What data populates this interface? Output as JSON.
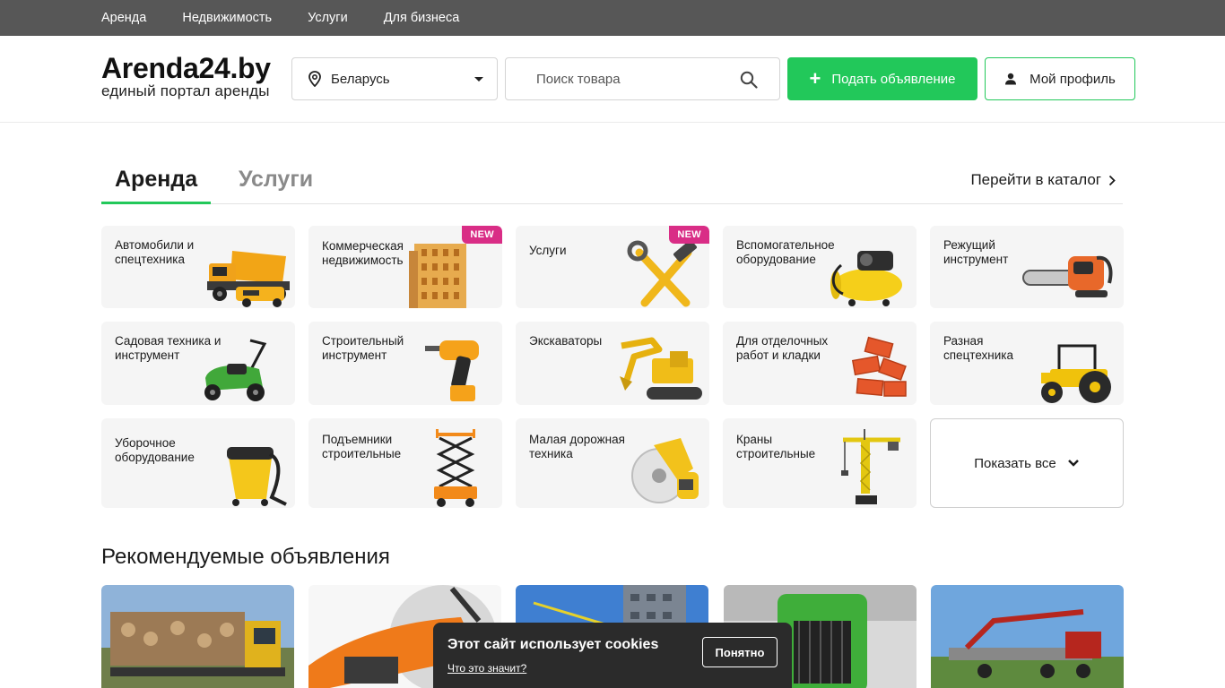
{
  "topnav": [
    "Аренда",
    "Недвижимость",
    "Услуги",
    "Для бизнеса"
  ],
  "header": {
    "logo_title": "Arenda24.by",
    "logo_sub": "единый портал аренды",
    "region": "Беларусь",
    "search_placeholder": "Поиск товара",
    "post_button": "Подать объявление",
    "profile_button": "Мой профиль"
  },
  "tabs": {
    "active": "Аренда",
    "inactive": "Услуги",
    "catalog_link": "Перейти в каталог"
  },
  "categories": [
    {
      "label": "Автомобили и спецтехника",
      "icon": "dump-truck-icon"
    },
    {
      "label": "Коммерческая недвижимость",
      "icon": "building-icon",
      "badge": "NEW"
    },
    {
      "label": "Услуги",
      "icon": "hammer-wrench-icon",
      "badge": "NEW"
    },
    {
      "label": "Вспомогательное оборудование",
      "icon": "compressor-icon"
    },
    {
      "label": "Режущий инструмент",
      "icon": "chainsaw-icon"
    },
    {
      "label": "Садовая техника и инструмент",
      "icon": "lawn-mower-icon"
    },
    {
      "label": "Строительный инструмент",
      "icon": "drill-icon"
    },
    {
      "label": "Экскаваторы",
      "icon": "excavator-icon"
    },
    {
      "label": "Для отделочных работ и кладки",
      "icon": "bricks-icon"
    },
    {
      "label": "Разная спецтехника",
      "icon": "tractor-icon"
    },
    {
      "label": "Уборочное оборудование",
      "icon": "vacuum-icon"
    },
    {
      "label": "Подъемники строительные",
      "icon": "scissor-lift-icon"
    },
    {
      "label": "Малая дорожная техника",
      "icon": "cut-off-saw-icon"
    },
    {
      "label": "Краны строительные",
      "icon": "tower-crane-icon"
    }
  ],
  "show_all": "Показать все",
  "recommended_title": "Рекомендуемые объявления",
  "cookie": {
    "text": "Этот сайт использует cookies",
    "link": "Что это значит?",
    "button": "Понятно"
  },
  "colors": {
    "accent": "#22c85a",
    "badge": "#d92d86",
    "topnav": "#575757"
  }
}
